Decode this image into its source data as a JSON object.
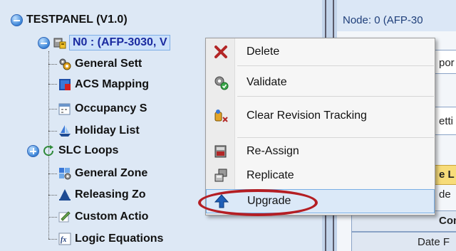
{
  "tree": {
    "root_label": "TESTPANEL (V1.0)",
    "node_label": "N0 : (AFP-3030, V",
    "children": [
      {
        "label": "General Sett",
        "icon": "gears-icon"
      },
      {
        "label": "ACS Mapping",
        "icon": "acs-map-icon"
      },
      {
        "label": "Occupancy S",
        "icon": "calendar-icon"
      },
      {
        "label": "Holiday List",
        "icon": "sailboat-icon"
      },
      {
        "label": "SLC Loops",
        "icon": "loop-refresh-icon"
      },
      {
        "label": "General Zone",
        "icon": "zone-gear-icon"
      },
      {
        "label": "Releasing Zo",
        "icon": "releasing-icon"
      },
      {
        "label": "Custom Actio",
        "icon": "custom-action-icon"
      },
      {
        "label": "Logic Equations",
        "icon": "fx-icon"
      }
    ]
  },
  "right_panel": {
    "node_header": "Node: 0 (AFP-30",
    "fields": [
      "por",
      "etti",
      "e L",
      "de",
      "Comm",
      "Date F"
    ]
  },
  "context_menu": {
    "items": [
      {
        "label": "Delete",
        "icon": "delete-x-icon"
      },
      {
        "label": "Validate",
        "icon": "validate-gear-icon"
      },
      {
        "label": "Clear Revision Tracking",
        "icon": "clear-revision-icon"
      },
      {
        "label": "Re-Assign",
        "icon": "reassign-icon"
      },
      {
        "label": "Replicate",
        "icon": "replicate-icon"
      },
      {
        "label": "Upgrade",
        "icon": "upgrade-arrow-icon",
        "highlighted": true
      }
    ]
  },
  "colors": {
    "tree_background": "#dde8f5",
    "selection_text": "#1a2aa0",
    "menu_hover": "#dbe9f8",
    "highlight_ring": "#b41e23"
  }
}
